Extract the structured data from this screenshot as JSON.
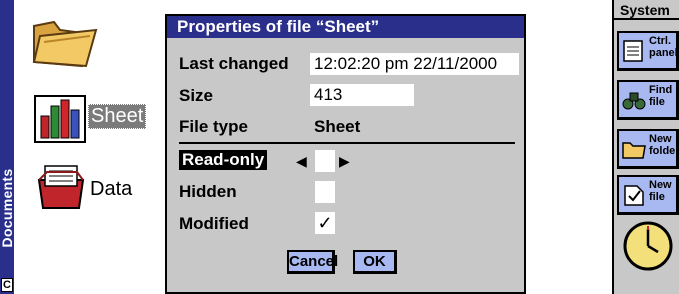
{
  "sidebar": {
    "title": "Documents",
    "corner_label": "C"
  },
  "desktop": {
    "items": [
      {
        "label": "Sheet"
      },
      {
        "label": "Data"
      }
    ]
  },
  "dialog": {
    "title": "Properties of file “Sheet”",
    "fields": {
      "last_changed_label": "Last changed",
      "last_changed_value": "12:02:20 pm 22/11/2000",
      "size_label": "Size",
      "size_value": "413",
      "file_type_label": "File type",
      "file_type_value": "Sheet",
      "readonly_label": "Read-only",
      "hidden_label": "Hidden",
      "modified_label": "Modified",
      "modified_check": "✓"
    },
    "buttons": {
      "cancel": "Cancel",
      "ok": "OK"
    }
  },
  "toolbar": {
    "header": "System",
    "items": [
      {
        "label": "Ctrl. panel"
      },
      {
        "label": "Find file"
      },
      {
        "label": "New folder"
      },
      {
        "label": "New file"
      }
    ]
  },
  "colors": {
    "accent_blue": "#2a2f8c",
    "button_blue": "#a8b8f0",
    "dialog_bg": "#c8c8c8"
  }
}
